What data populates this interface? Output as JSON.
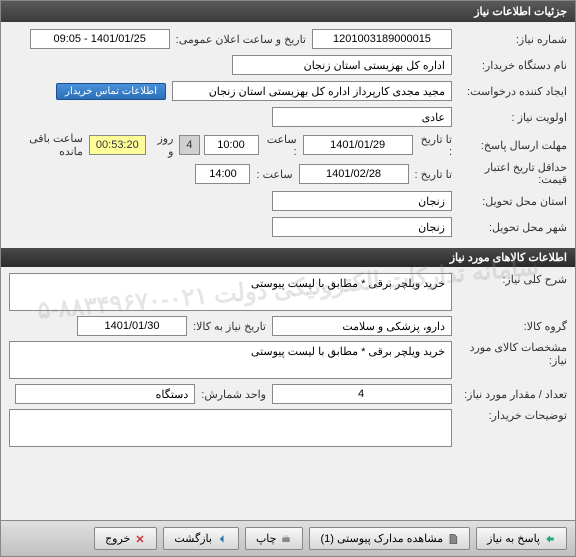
{
  "window_title": "جزئیات اطلاعات نیاز",
  "section1": {
    "need_no_label": "شماره نیاز:",
    "need_no": "1201003189000015",
    "announce_label": "تاریخ و ساعت اعلان عمومی:",
    "announce_datetime": "1401/01/25 - 09:05",
    "buyer_label": "نام دستگاه خریدار:",
    "buyer": "اداره کل بهزیستی استان زنجان",
    "requester_label": "ایجاد کننده درخواست:",
    "requester": "مجید مجدی کارپرداز اداره کل بهزیستی استان زنجان",
    "contact_btn": "اطلاعات تماس خریدار",
    "priority_label": "اولویت نیاز :",
    "priority": "عادی",
    "deadline_label": "مهلت ارسال پاسخ:",
    "to_date_label": "تا تاریخ :",
    "deadline_date": "1401/01/29",
    "time_label": "ساعت :",
    "deadline_time": "10:00",
    "remain_days": "4",
    "remain_days_label": "روز و",
    "remain_time": "00:53:20",
    "remain_suffix": "ساعت باقی مانده",
    "validity_label": "حداقل تاریخ اعتبار قیمت:",
    "validity_date": "1401/02/28",
    "validity_time": "14:00",
    "province_label": "استان محل تحویل:",
    "province": "زنجان",
    "city_label": "شهر محل تحویل:",
    "city": "زنجان"
  },
  "section2_header": "اطلاعات کالاهای مورد نیاز",
  "section2": {
    "desc_label": "شرح کلی نیاز:",
    "desc": "خرید ویلچر برقی * مطابق با لیست پیوستی",
    "group_label": "گروه کالا:",
    "group": "دارو، پزشکی و سلامت",
    "need_date_label": "تاریخ نیاز به کالا:",
    "need_date": "1401/01/30",
    "spec_label": "مشخصات کالای مورد نیاز:",
    "spec": "خرید ویلچر برقی * مطابق با لیست پیوستی",
    "qty_label": "تعداد / مقدار مورد نیاز:",
    "qty": "4",
    "unit_label": "واحد شمارش:",
    "unit": "دستگاه",
    "notes_label": "توضیحات خریدار:",
    "notes": ""
  },
  "footer": {
    "reply": "پاسخ به نیاز",
    "attach": "مشاهده مدارک پیوستی (1)",
    "print": "چاپ",
    "back": "بازگشت",
    "exit": "خروج"
  },
  "watermark": "سامانه تدارکات الکترونیکی دولت\n۰۲۱-۸۸۳۴۹۶۷۰-۵"
}
